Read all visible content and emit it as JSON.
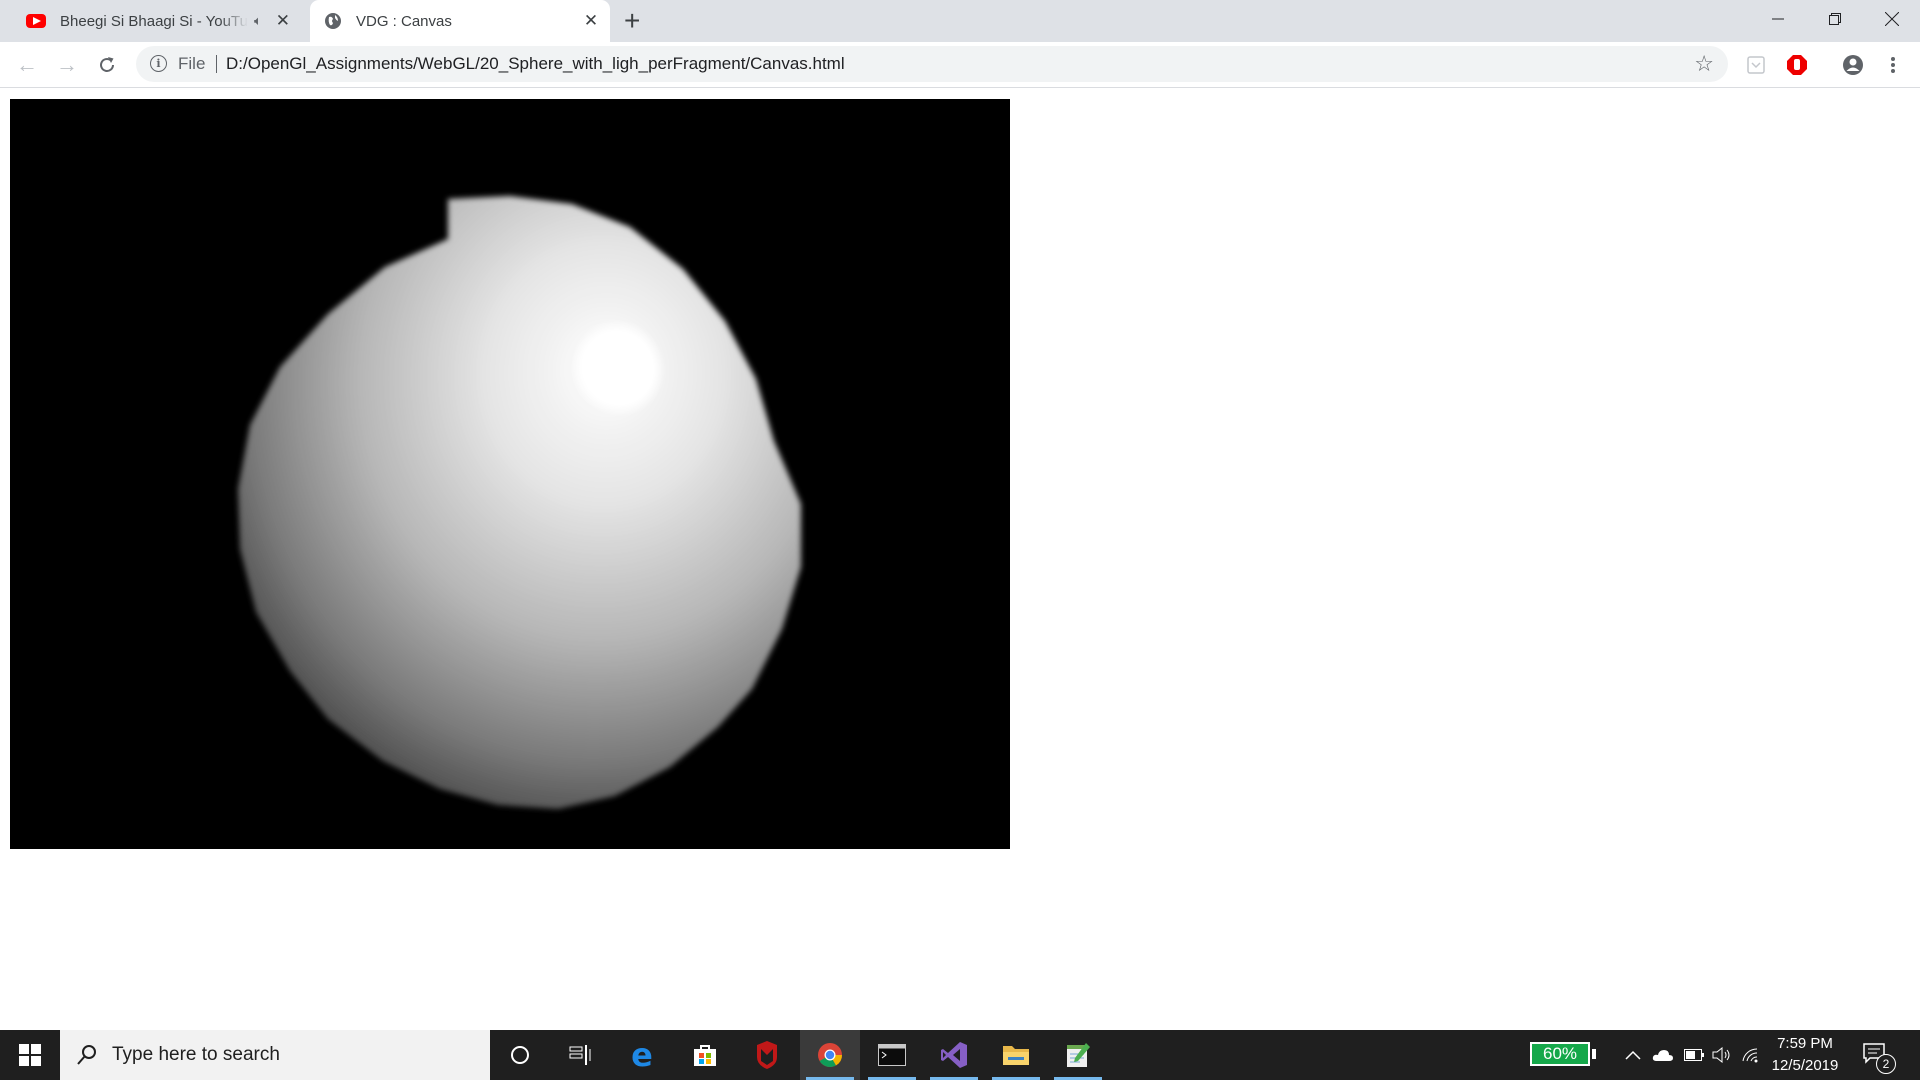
{
  "browser": {
    "tabs": [
      {
        "title": "Bheegi Si Bhaagi Si - YouTube",
        "favicon": "youtube-icon",
        "audio": "audio-playing-icon",
        "active": false
      },
      {
        "title": "VDG : Canvas",
        "favicon": "globe-icon",
        "active": true
      }
    ],
    "new_tab_label": "+",
    "address_bar": {
      "scheme_label": "File",
      "url": "D:/OpenGl_Assignments/WebGL/20_Sphere_with_ligh_perFragment/Canvas.html"
    },
    "extensions": [
      "pocket-icon",
      "adblock-icon",
      "profile-icon",
      "menu-icon"
    ]
  },
  "page": {
    "canvas": {
      "background": "#000000",
      "scene": "lit sphere with specular highlight",
      "sphere_color": "#ffffff"
    }
  },
  "taskbar": {
    "search_placeholder": "Type here to search",
    "apps": [
      "cortana-icon",
      "task-view-icon",
      "edge-icon",
      "store-icon",
      "mcafee-icon",
      "chrome-icon",
      "terminal-icon",
      "visual-studio-icon",
      "file-explorer-icon",
      "notepad-icon"
    ],
    "battery_percent": "60%",
    "clock_time": "7:59 PM",
    "clock_date": "12/5/2019",
    "notification_count": "2",
    "accent_color": "#15a84a"
  }
}
